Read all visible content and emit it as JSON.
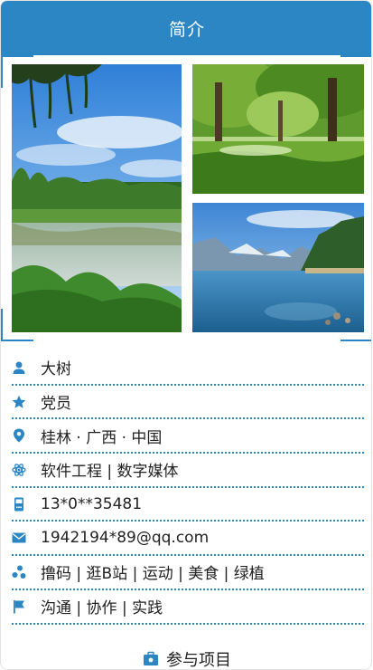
{
  "header": {
    "title": "简介"
  },
  "photos": [
    {
      "name": "lake-with-willow-photo"
    },
    {
      "name": "green-forest-photo"
    },
    {
      "name": "mountain-lake-photo"
    }
  ],
  "profile": {
    "name": "大树",
    "status": "党员",
    "location": "桂林 · 广西 · 中国",
    "major": "软件工程 | 数字媒体",
    "phone": "13*0**35481",
    "email": "1942194*89@qq.com",
    "hobbies": "撸码 | 逛B站 | 运动 | 美食 | 绿植",
    "skills": "沟通 | 协作 | 实践"
  },
  "icons": {
    "person": "person-icon",
    "star": "star-icon",
    "location": "location-pin-icon",
    "atom": "atom-icon",
    "phone": "phone-icon",
    "mail": "mail-icon",
    "share": "hobby-dots-icon",
    "flag": "flag-icon",
    "project": "project-icon"
  },
  "footer": {
    "label": "参与项目"
  },
  "colors": {
    "accent": "#2d86c4"
  }
}
